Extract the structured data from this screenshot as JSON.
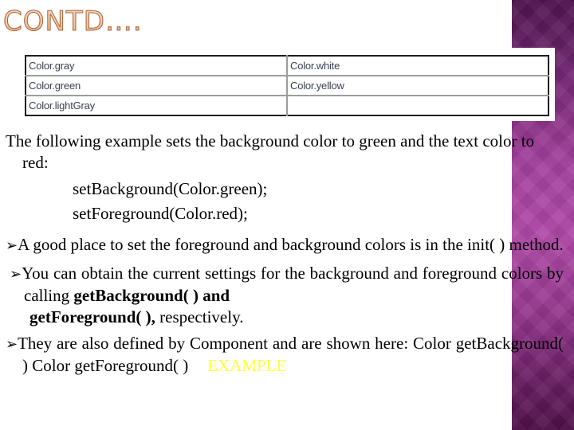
{
  "slide": {
    "title": "CONTD….",
    "accent_colors": {
      "band_purple_top": "#4e1550",
      "band_purple_mid": "#b04aa8",
      "band_purple_bottom": "#4f1048",
      "title_fill": "#f8bf99",
      "title_outline": "#a1683f",
      "example_link": "#ffff40"
    }
  },
  "color_table": {
    "rows": [
      [
        "Color.gray",
        "Color.white"
      ],
      [
        "Color.green",
        "Color.yellow"
      ],
      [
        "Color.lightGray",
        ""
      ]
    ]
  },
  "body": {
    "intro": "The following example sets the background color to green and the text color to red:",
    "code_lines": [
      "setBackground(Color.green);",
      "setForeground(Color.red);"
    ],
    "bullet_symbol": "➢",
    "bullets": [
      {
        "text": "A good place to set the foreground and background colors is in the init( ) method."
      },
      {
        "text_before": "You can obtain the current settings for the background and foreground colors by calling ",
        "bold_1": "getBackground( ) and",
        "bold_2": "getForeground( ),",
        "text_after": " respectively."
      },
      {
        "text": "They are also defined by Component and are shown here: Color getBackground( ) Color getForeground( )",
        "link_label": "EXAMPLE"
      }
    ]
  }
}
